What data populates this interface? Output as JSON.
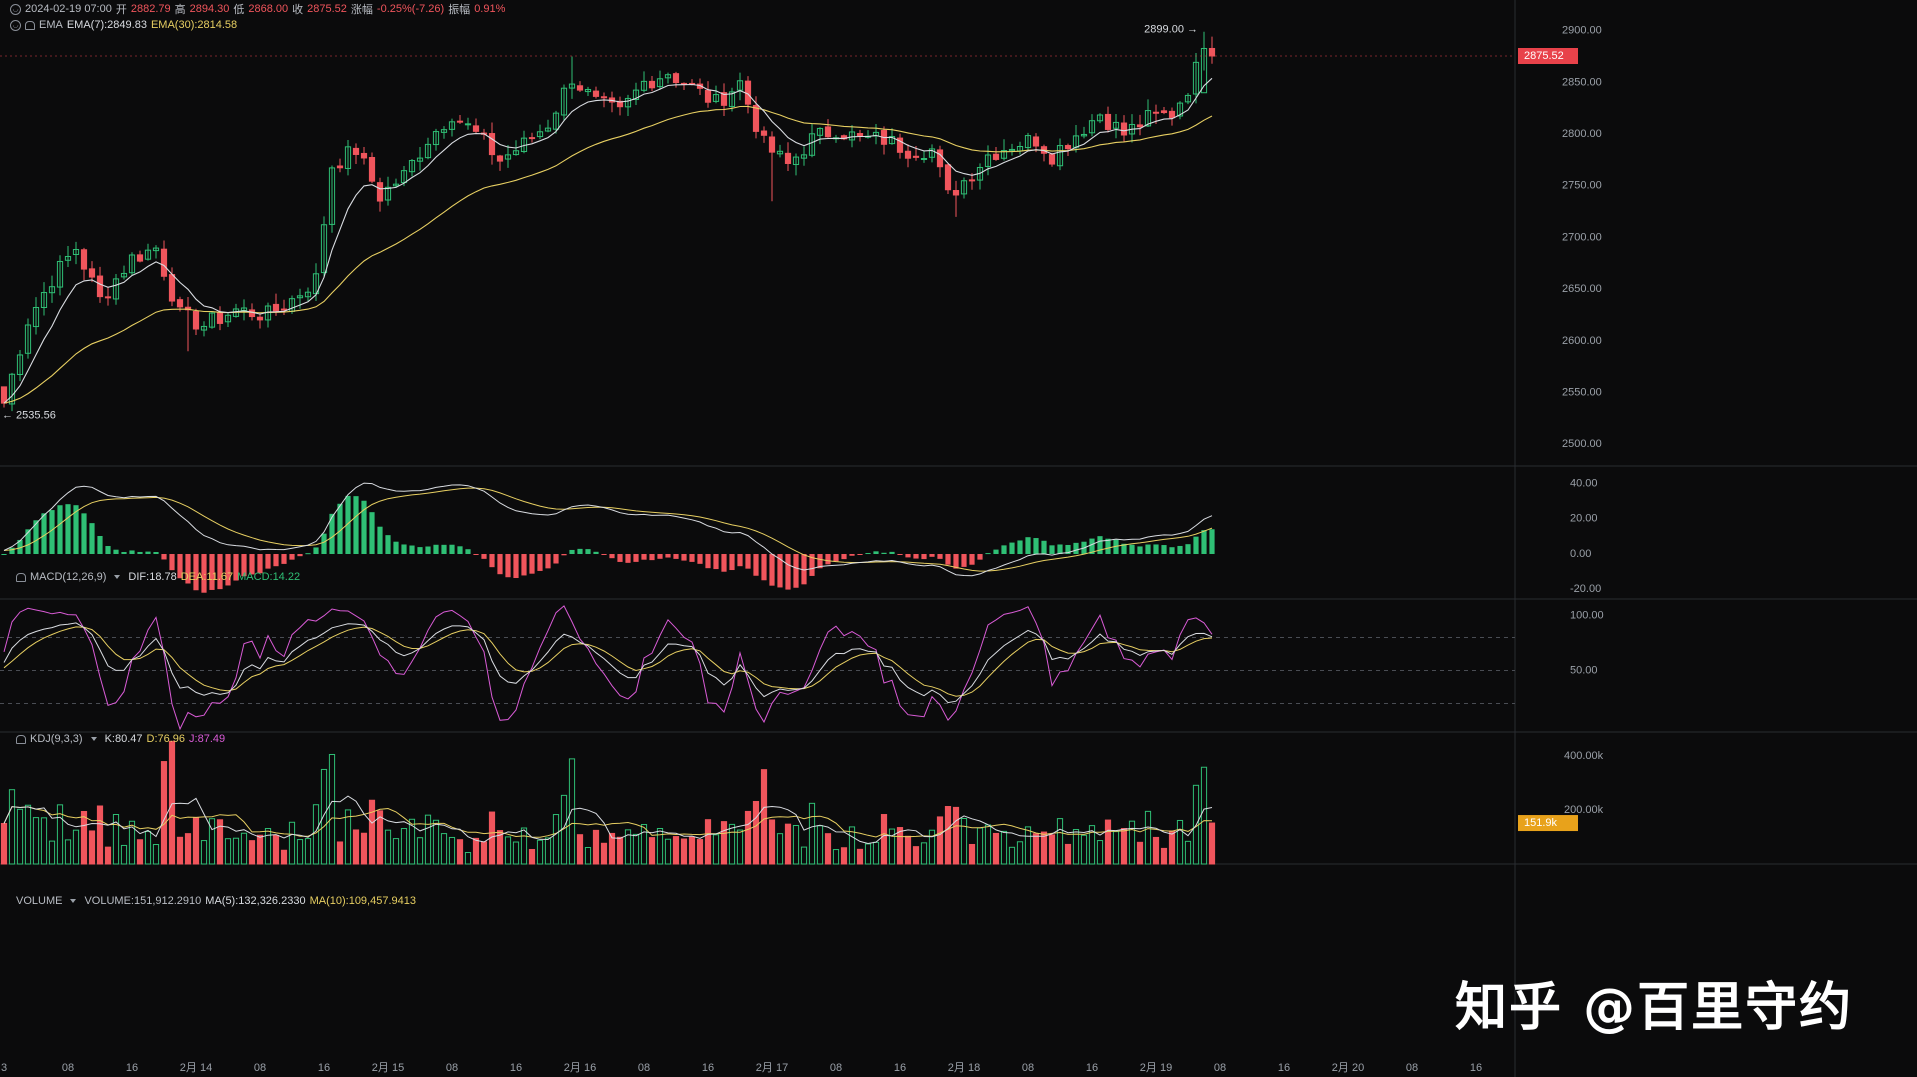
{
  "header": {
    "datetime": "2024-02-19 07:00",
    "open_label": "开",
    "open": "2882.79",
    "high_label": "高",
    "high": "2894.30",
    "low_label": "低",
    "low": "2868.00",
    "close_label": "收",
    "close": "2875.52",
    "change_label": "涨幅",
    "change": "-0.25%(-7.26)",
    "amp_label": "振幅",
    "amp": "0.91%"
  },
  "ema_legend": {
    "name": "EMA",
    "ema7": "EMA(7):2849.83",
    "ema30": "EMA(30):2814.58"
  },
  "macd_legend": {
    "name": "MACD(12,26,9)",
    "dif": "DIF:18.78",
    "dea": "DEA:11.67",
    "macd": "MACD:14.22"
  },
  "kdj_legend": {
    "name": "KDJ(9,3,3)",
    "k": "K:80.47",
    "d": "D:76.96",
    "j": "J:87.49"
  },
  "volume_legend": {
    "name": "VOLUME",
    "vol": "VOLUME:151,912.2910",
    "ma5": "MA(5):132,326.2330",
    "ma10": "MA(10):109,457.9413"
  },
  "watermark": "知乎 @百里守约",
  "colors": {
    "up": "#2fbf75",
    "down": "#f0555c",
    "ema7": "#d9dce1",
    "ema30": "#e7cf62",
    "k": "#d9dce1",
    "d": "#e7cf62",
    "j": "#d95bd6",
    "price_tag": "#e8424a",
    "volume_tag": "#e8a21b"
  },
  "chart_data": {
    "type": "candlestick",
    "interval": "1h",
    "price_axis": {
      "ticks": [
        2500,
        2550,
        2600,
        2650,
        2700,
        2750,
        2800,
        2850,
        2900
      ],
      "tick_labels": [
        "2500.00",
        "2550.00",
        "2600.00",
        "2650.00",
        "2700.00",
        "2750.00",
        "2800.00",
        "2850.00",
        "2900.00"
      ],
      "range": [
        2480,
        2920
      ]
    },
    "max_label": "2899.00 →",
    "max_value": 2899.0,
    "min_label": "← 2535.56",
    "min_value": 2535.56,
    "last_price_label": "2875.52",
    "last_price": 2875.52,
    "time_axis": {
      "labels": [
        {
          "text": "3",
          "idx": 0
        },
        {
          "text": "08",
          "idx": 8
        },
        {
          "text": "16",
          "idx": 16
        },
        {
          "text": "2月 14",
          "idx": 24
        },
        {
          "text": "08",
          "idx": 32
        },
        {
          "text": "16",
          "idx": 40
        },
        {
          "text": "2月 15",
          "idx": 48
        },
        {
          "text": "08",
          "idx": 56
        },
        {
          "text": "16",
          "idx": 64
        },
        {
          "text": "2月 16",
          "idx": 72
        },
        {
          "text": "08",
          "idx": 80
        },
        {
          "text": "16",
          "idx": 88
        },
        {
          "text": "2月 17",
          "idx": 96
        },
        {
          "text": "08",
          "idx": 104
        },
        {
          "text": "16",
          "idx": 112
        },
        {
          "text": "2月 18",
          "idx": 120
        },
        {
          "text": "08",
          "idx": 128
        },
        {
          "text": "16",
          "idx": 136
        },
        {
          "text": "2月 19",
          "idx": 144
        },
        {
          "text": "08",
          "idx": 152
        },
        {
          "text": "16",
          "idx": 160
        },
        {
          "text": "2月 20",
          "idx": 168
        },
        {
          "text": "08",
          "idx": 176
        },
        {
          "text": "16",
          "idx": 184
        }
      ]
    },
    "anchors": [
      {
        "i": 0,
        "p": 2540
      },
      {
        "i": 3,
        "p": 2620
      },
      {
        "i": 6,
        "p": 2660
      },
      {
        "i": 9,
        "p": 2690
      },
      {
        "i": 12,
        "p": 2640
      },
      {
        "i": 16,
        "p": 2680
      },
      {
        "i": 19,
        "p": 2690
      },
      {
        "i": 22,
        "p": 2625
      },
      {
        "i": 25,
        "p": 2615
      },
      {
        "i": 29,
        "p": 2630
      },
      {
        "i": 33,
        "p": 2625
      },
      {
        "i": 36,
        "p": 2640
      },
      {
        "i": 39,
        "p": 2660
      },
      {
        "i": 41,
        "p": 2770
      },
      {
        "i": 44,
        "p": 2785
      },
      {
        "i": 47,
        "p": 2740
      },
      {
        "i": 50,
        "p": 2760
      },
      {
        "i": 53,
        "p": 2795
      },
      {
        "i": 56,
        "p": 2820
      },
      {
        "i": 59,
        "p": 2800
      },
      {
        "i": 62,
        "p": 2775
      },
      {
        "i": 65,
        "p": 2790
      },
      {
        "i": 68,
        "p": 2810
      },
      {
        "i": 71,
        "p": 2855
      },
      {
        "i": 74,
        "p": 2830
      },
      {
        "i": 77,
        "p": 2820
      },
      {
        "i": 80,
        "p": 2850
      },
      {
        "i": 83,
        "p": 2860
      },
      {
        "i": 86,
        "p": 2845
      },
      {
        "i": 89,
        "p": 2830
      },
      {
        "i": 92,
        "p": 2850
      },
      {
        "i": 95,
        "p": 2790
      },
      {
        "i": 98,
        "p": 2770
      },
      {
        "i": 101,
        "p": 2795
      },
      {
        "i": 104,
        "p": 2805
      },
      {
        "i": 107,
        "p": 2795
      },
      {
        "i": 110,
        "p": 2795
      },
      {
        "i": 113,
        "p": 2785
      },
      {
        "i": 116,
        "p": 2785
      },
      {
        "i": 118,
        "p": 2740
      },
      {
        "i": 120,
        "p": 2755
      },
      {
        "i": 123,
        "p": 2780
      },
      {
        "i": 126,
        "p": 2790
      },
      {
        "i": 129,
        "p": 2795
      },
      {
        "i": 131,
        "p": 2780
      },
      {
        "i": 134,
        "p": 2800
      },
      {
        "i": 137,
        "p": 2820
      },
      {
        "i": 140,
        "p": 2800
      },
      {
        "i": 143,
        "p": 2815
      },
      {
        "i": 146,
        "p": 2820
      },
      {
        "i": 148,
        "p": 2845
      },
      {
        "i": 150,
        "p": 2880
      },
      {
        "i": 151,
        "p": 2875.52
      }
    ],
    "volume_axis": {
      "ticks": [
        200000,
        400000
      ],
      "tick_labels": [
        "200.00k",
        "400.00k"
      ],
      "max": 460000
    },
    "volume_last_label": "151.9k",
    "volume_last": 151912.291,
    "macd_axis": {
      "ticks": [
        -20,
        0,
        20,
        40
      ],
      "tick_labels": [
        "-20.00",
        "0.00",
        "20.00",
        "40.00"
      ],
      "range": [
        -25,
        50
      ]
    },
    "kdj_axis": {
      "ticks": [
        50,
        100
      ],
      "tick_labels": [
        "50.00",
        "100.00"
      ],
      "dashed": [
        20,
        50,
        80
      ],
      "range": [
        -5,
        115
      ]
    }
  }
}
